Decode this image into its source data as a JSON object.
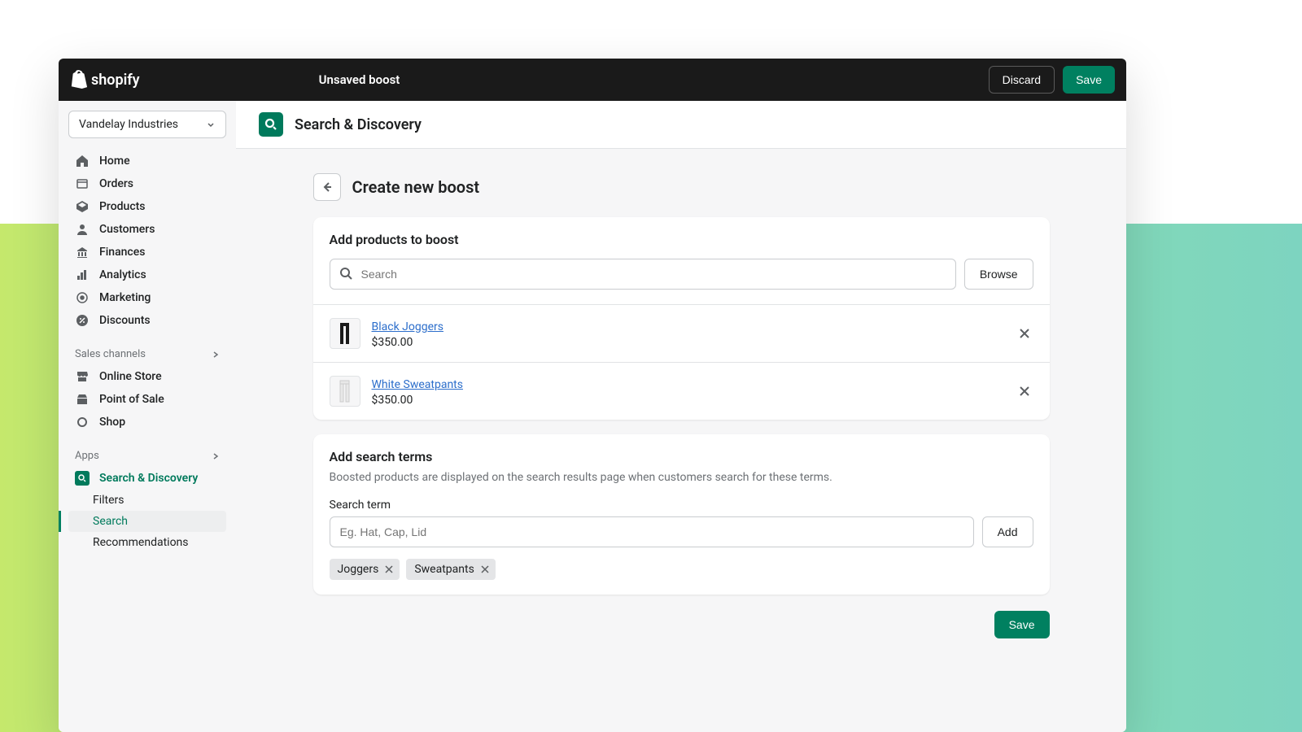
{
  "brand": "shopify",
  "topbar": {
    "title": "Unsaved boost",
    "discard": "Discard",
    "save": "Save"
  },
  "store_selector": "Vandelay Industries",
  "nav": {
    "main": [
      "Home",
      "Orders",
      "Products",
      "Customers",
      "Finances",
      "Analytics",
      "Marketing",
      "Discounts"
    ],
    "sales_label": "Sales channels",
    "sales": [
      "Online Store",
      "Point of Sale",
      "Shop"
    ],
    "apps_label": "Apps",
    "app_name": "Search & Discovery",
    "app_sub": [
      "Filters",
      "Search",
      "Recommendations"
    ]
  },
  "page_header": "Search & Discovery",
  "page_title": "Create new boost",
  "boost_card": {
    "title": "Add products to boost",
    "search_placeholder": "Search",
    "browse": "Browse",
    "products": [
      {
        "name": "Black Joggers",
        "price": "$350.00"
      },
      {
        "name": "White Sweatpants",
        "price": "$350.00"
      }
    ]
  },
  "terms_card": {
    "title": "Add search terms",
    "helper": "Boosted products are displayed on the search results page when customers search for these terms.",
    "label": "Search term",
    "placeholder": "Eg. Hat, Cap, Lid",
    "add": "Add",
    "tags": [
      "Joggers",
      "Sweatpants"
    ]
  },
  "footer_save": "Save"
}
